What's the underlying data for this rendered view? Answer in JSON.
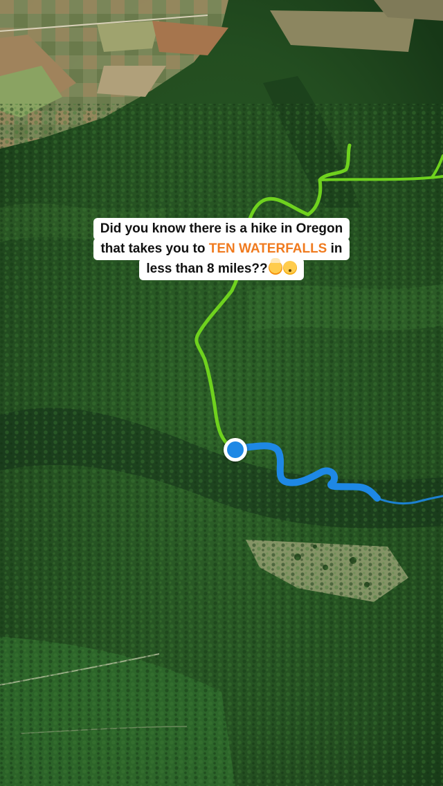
{
  "map": {
    "view": "3D satellite terrain",
    "colors": {
      "forest_dark": "#1a3d1a",
      "forest_mid": "#2a5a26",
      "forest_light": "#3f7a33",
      "farmland": "#8a7a55",
      "meadow": "#8f9a6e",
      "upcoming_trail": "#6fd21e",
      "traveled_trail": "#1e88e5",
      "faint_trail": "#1e88e5"
    },
    "location_marker": {
      "icon": "current-location-dot",
      "color": "#1e88e5",
      "ring_color": "#ffffff"
    }
  },
  "caption": {
    "line1": "Did you know there is a hike in Oregon",
    "line2_before": "that takes you to ",
    "line2_highlight": "TEN WATERFALLS",
    "line2_after": " in",
    "line3": "less than 8 miles??",
    "emojis": [
      "mind-blown-emoji",
      "shushing-face-emoji"
    ],
    "highlight_color": "#f07a1e"
  }
}
